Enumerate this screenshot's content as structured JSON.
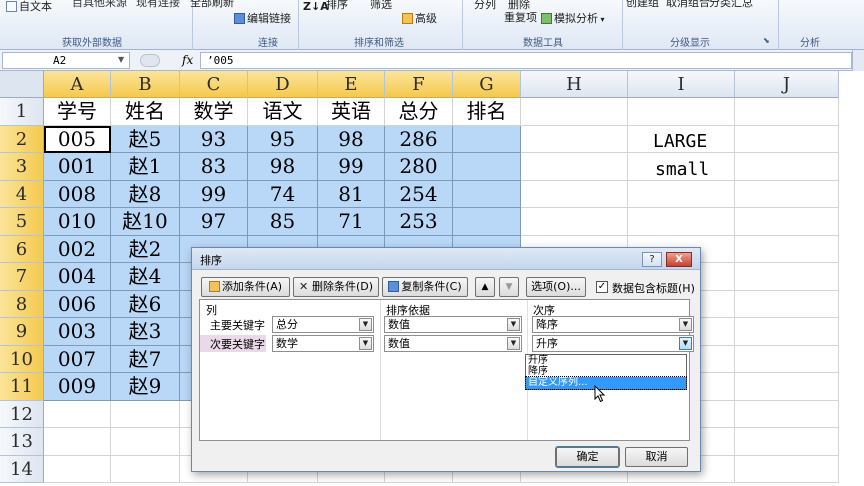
{
  "ribbon": {
    "partial_top_left": "自文本",
    "partial_top1": "目具他来源",
    "partial_top2": "现有连接",
    "refresh_all": "全部刷新",
    "edit_links": "编辑链接",
    "sort_icon": "Z↓A",
    "sort": "排序",
    "filter": "筛选",
    "advanced": "高级",
    "text_to_columns": "分列",
    "remove_duplicates": "删除\n重复项",
    "remove_dup_top": "删除",
    "remove_dup_bottom": "重复项",
    "what_if": "模拟分析",
    "group": "创建组",
    "ungroup": "取消组合",
    "subtotal": "分类汇总",
    "groups": {
      "external_data": "获取外部数据",
      "connections": "连接",
      "sort_filter": "排序和筛选",
      "data_tools": "数据工具",
      "outline": "分级显示",
      "analysis": "分析"
    }
  },
  "formula_bar": {
    "name_box": "A2",
    "fx": "fx",
    "value": "’005"
  },
  "grid": {
    "columns": [
      "A",
      "B",
      "C",
      "D",
      "E",
      "F",
      "G",
      "H",
      "I",
      "J"
    ],
    "rows": [
      "1",
      "2",
      "3",
      "4",
      "5",
      "6",
      "7",
      "8",
      "9",
      "10",
      "11",
      "12",
      "13",
      "14"
    ],
    "header": [
      "学号",
      "姓名",
      "数学",
      "语文",
      "英语",
      "总分",
      "排名"
    ],
    "data": [
      [
        "005",
        "赵5",
        "93",
        "95",
        "98",
        "286",
        ""
      ],
      [
        "001",
        "赵1",
        "83",
        "98",
        "99",
        "280",
        ""
      ],
      [
        "008",
        "赵8",
        "99",
        "74",
        "81",
        "254",
        ""
      ],
      [
        "010",
        "赵10",
        "97",
        "85",
        "71",
        "253",
        ""
      ],
      [
        "002",
        "赵2",
        "",
        "",
        "",
        "",
        ""
      ],
      [
        "004",
        "赵4",
        "",
        "",
        "",
        "",
        ""
      ],
      [
        "006",
        "赵6",
        "",
        "",
        "",
        "",
        ""
      ],
      [
        "003",
        "赵3",
        "",
        "",
        "",
        "",
        ""
      ],
      [
        "007",
        "赵7",
        "",
        "",
        "",
        "",
        ""
      ],
      [
        "009",
        "赵9",
        "",
        "",
        "",
        "",
        ""
      ]
    ],
    "side_labels": [
      "LARGE",
      "small"
    ]
  },
  "dialog": {
    "title": "排序",
    "help": "?",
    "close": "X",
    "add_level": "添加条件(A)",
    "delete_level": "删除条件(D)",
    "copy_level": "复制条件(C)",
    "move_up": "▲",
    "move_down": "▼",
    "options": "选项(O)...",
    "has_headers": "数据包含标题(H)",
    "has_headers_checked": "✓",
    "col_header": "列",
    "sort_on_header": "排序依据",
    "order_header": "次序",
    "rows": [
      {
        "label": "主要关键字",
        "column": "总分",
        "sort_on": "数值",
        "order": "降序"
      },
      {
        "label": "次要关键字",
        "column": "数学",
        "sort_on": "数值",
        "order": "升序"
      }
    ],
    "dropdown_options": [
      "升序",
      "降序",
      "自定义序列..."
    ],
    "ok": "确定",
    "cancel": "取消"
  }
}
